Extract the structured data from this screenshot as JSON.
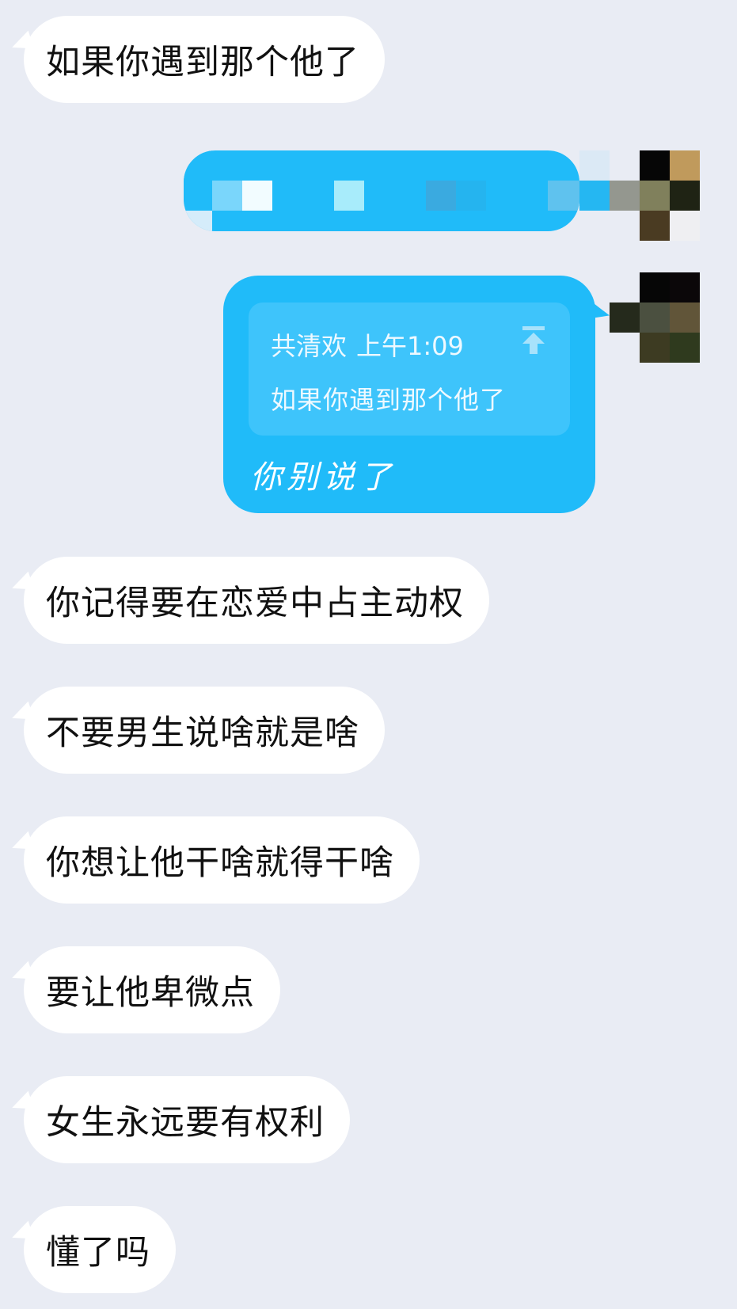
{
  "messages_in_top": {
    "m1": "如果你遇到那个他了"
  },
  "reply": {
    "quote_sender": "共清欢",
    "quote_time": "上午1:09",
    "quote_text": "如果你遇到那个他了",
    "text": "你别说了"
  },
  "messages_in": {
    "m2": "你记得要在恋爱中占主动权",
    "m3": "不要男生说啥就是啥",
    "m4": "你想让他干啥就得干啥",
    "m5": "要让他卑微点",
    "m6": "女生永远要有权利",
    "m7": "懂了吗"
  },
  "colors": {
    "background": "#e9ecf4",
    "bubble_in": "#ffffff",
    "bubble_out": "#20bbf9",
    "quote_box": "#3ec4fb"
  },
  "icons": {
    "pin": "pin-to-top-icon"
  }
}
